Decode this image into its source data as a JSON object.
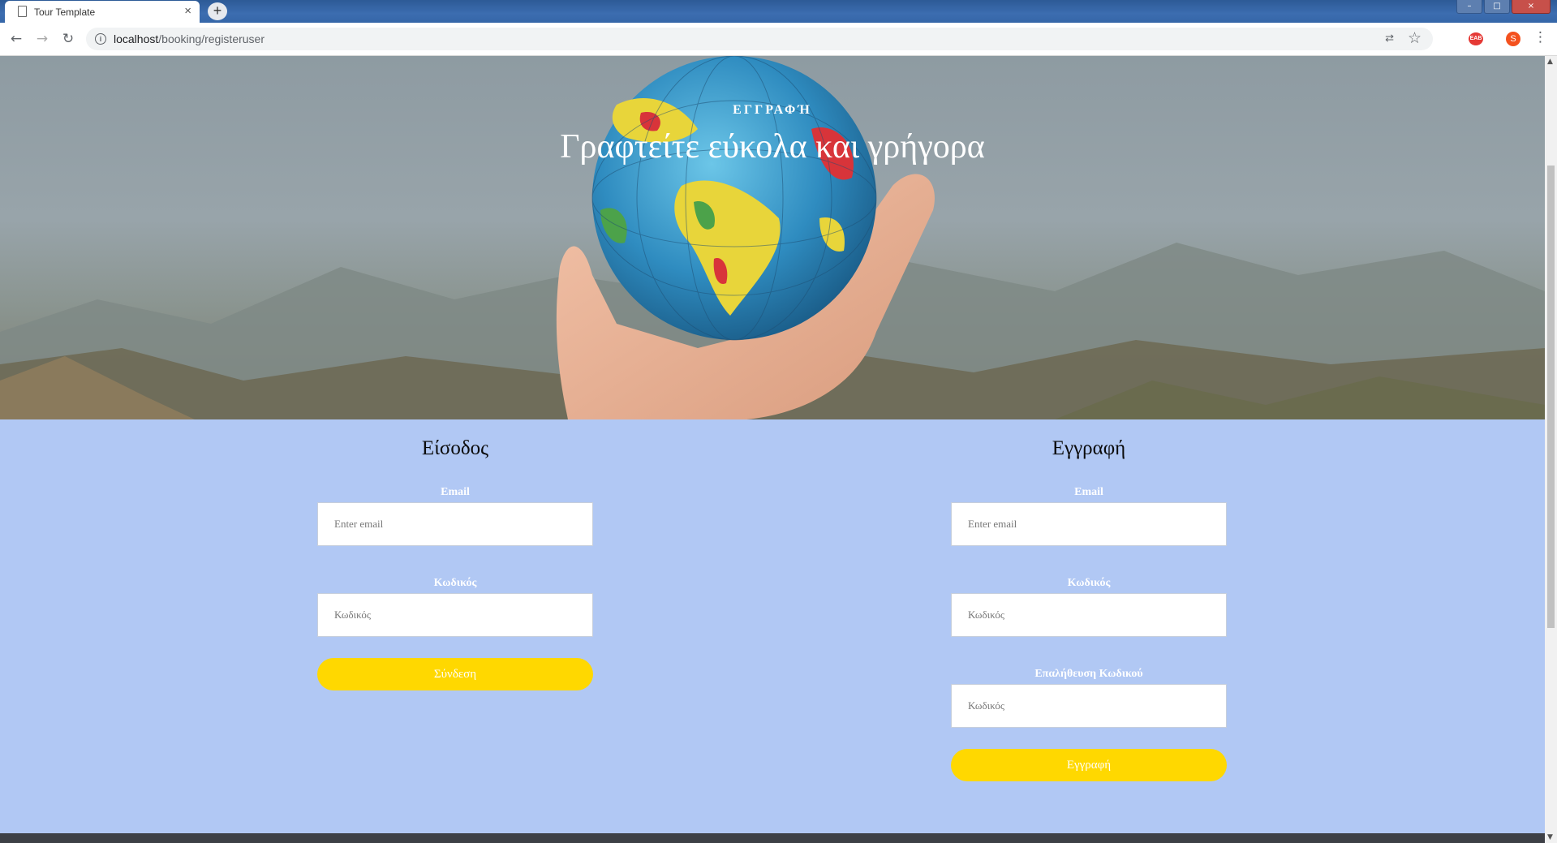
{
  "browser": {
    "tab_title": "Tour Template",
    "tab_close": "×",
    "new_tab": "+",
    "window_controls": [
      "–",
      "□",
      "×"
    ],
    "url_host": "localhost",
    "url_path": "/booking/registeruser",
    "extension_label": "EAB",
    "profile_initial": "S",
    "icons": {
      "back": "←",
      "forward": "→",
      "reload": "↻",
      "info": "i",
      "translate": "⇄",
      "star": "☆",
      "menu": "⋮",
      "scroll_up": "▲",
      "scroll_down": "▼"
    }
  },
  "hero": {
    "eyebrow": "ΕΓΓΡΑΦΉ",
    "title": "Γραφτείτε εύκολα και γρήγορα"
  },
  "login": {
    "heading": "Είσοδος",
    "email_label": "Email",
    "email_placeholder": "Enter email",
    "password_label": "Κωδικός",
    "password_placeholder": "Κωδικός",
    "submit_label": "Σύνδεση"
  },
  "register": {
    "heading": "Εγγραφή",
    "email_label": "Email",
    "email_placeholder": "Enter email",
    "password_label": "Κωδικός",
    "password_placeholder": "Κωδικός",
    "confirm_label": "Επαλήθευση Κωδικού",
    "confirm_placeholder": "Κωδικός",
    "submit_label": "Εγγραφή"
  },
  "colors": {
    "section_bg": "#b1c8f4",
    "button": "#ffd800",
    "footer": "#3d4046"
  }
}
